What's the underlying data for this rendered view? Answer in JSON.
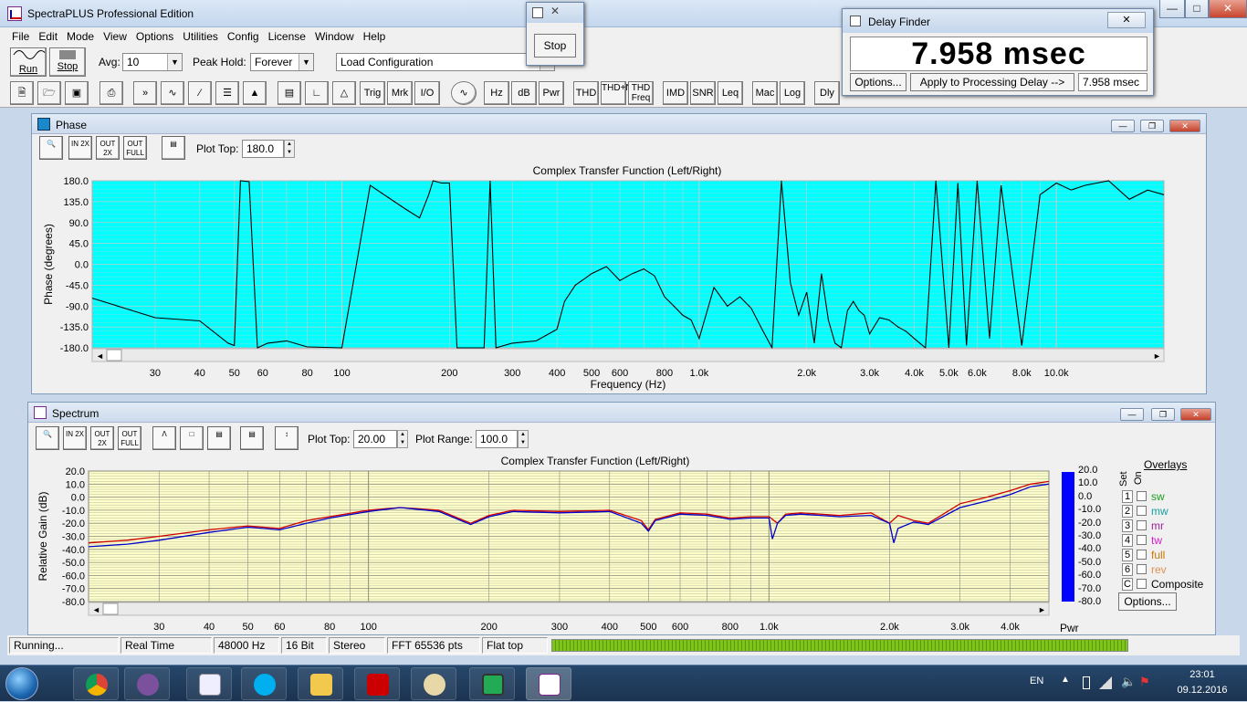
{
  "app": {
    "title": "SpectraPLUS Professional Edition"
  },
  "menu": [
    "File",
    "Edit",
    "Mode",
    "View",
    "Options",
    "Utilities",
    "Config",
    "License",
    "Window",
    "Help"
  ],
  "toolbar": {
    "run_label": "Run",
    "stop_label": "Stop",
    "avg_label": "Avg:",
    "avg_value": "10",
    "peak_hold_label": "Peak Hold:",
    "peak_hold_value": "Forever",
    "config_value": "Load Configuration",
    "buttons2": [
      "Trig",
      "Mrk",
      "I/O",
      "Hz",
      "dB",
      "Pwr",
      "THD",
      "THD+N",
      "THD Freq",
      "IMD",
      "SNR",
      "Leq",
      "Mac",
      "Log",
      "Dly"
    ]
  },
  "stop_window": {
    "stop_label": "Stop"
  },
  "delay_finder": {
    "title": "Delay Finder",
    "value": "7.958 msec",
    "options_label": "Options...",
    "apply_label": "Apply to Processing Delay -->",
    "result": "7.958 msec"
  },
  "phase_window": {
    "title": "Phase",
    "plot_top_label": "Plot Top:",
    "plot_top_value": "180.0",
    "zoom_labels": [
      "IN 2X",
      "OUT 2X",
      "OUT FULL"
    ]
  },
  "spectrum_window": {
    "title": "Spectrum",
    "plot_top_label": "Plot Top:",
    "plot_top_value": "20.00",
    "plot_range_label": "Plot Range:",
    "plot_range_value": "100.0",
    "zoom_labels": [
      "IN 2X",
      "OUT 2X",
      "OUT FULL"
    ],
    "pwr_label": "Pwr",
    "overlays_title": "Overlays",
    "set_label": "Set",
    "on_label": "On",
    "overlays": [
      {
        "n": "1",
        "name": "sw",
        "color": "#1a9e1a"
      },
      {
        "n": "2",
        "name": "mw",
        "color": "#1aa0a0"
      },
      {
        "n": "3",
        "name": "mr",
        "color": "#a0209a"
      },
      {
        "n": "4",
        "name": "tw",
        "color": "#d020c8"
      },
      {
        "n": "5",
        "name": "full",
        "color": "#c87800"
      },
      {
        "n": "6",
        "name": "rev",
        "color": "#e09050"
      },
      {
        "n": "C",
        "name": "Composite",
        "color": "#000000"
      }
    ],
    "overlays_options_label": "Options..."
  },
  "chart_data": [
    {
      "type": "line",
      "title": "Complex Transfer Function (Left/Right)",
      "xlabel": "Frequency (Hz)",
      "ylabel": "Phase (degrees)",
      "xscale": "log",
      "xlim": [
        20,
        20000
      ],
      "ylim": [
        -180,
        180
      ],
      "yticks": [
        "180.0",
        "135.0",
        "90.0",
        "45.0",
        "0.0",
        "-45.0",
        "-90.0",
        "-135.0",
        "-180.0"
      ],
      "xticks": [
        "30",
        "40",
        "50",
        "60",
        "80",
        "100",
        "200",
        "300",
        "400",
        "500",
        "600",
        "800",
        "1.0k",
        "2.0k",
        "3.0k",
        "4.0k",
        "5.0k",
        "6.0k",
        "8.0k",
        "10.0k"
      ],
      "background": "#00ffff",
      "series": [
        {
          "color": "#000000",
          "x": [
            20,
            30,
            40,
            48,
            50,
            52,
            55,
            58,
            62,
            70,
            80,
            100,
            120,
            150,
            165,
            175,
            180,
            190,
            200,
            210,
            230,
            250,
            260,
            270,
            300,
            350,
            400,
            420,
            450,
            480,
            500,
            550,
            600,
            650,
            700,
            750,
            800,
            850,
            900,
            950,
            1000,
            1100,
            1200,
            1300,
            1400,
            1500,
            1600,
            1700,
            1800,
            1900,
            2000,
            2100,
            2200,
            2300,
            2400,
            2500,
            2600,
            2700,
            2800,
            2900,
            3000,
            3200,
            3400,
            3600,
            3800,
            4000,
            4300,
            4600,
            5000,
            5300,
            5600,
            6000,
            6500,
            7000,
            8000,
            9000,
            10000,
            11000,
            12000,
            14000,
            16000,
            18000,
            20000
          ],
          "y": [
            -73,
            -115,
            -122,
            -170,
            -175,
            180,
            178,
            -180,
            -170,
            -165,
            -178,
            -180,
            170,
            120,
            100,
            150,
            180,
            175,
            175,
            -180,
            -180,
            -180,
            180,
            -180,
            -170,
            -165,
            -140,
            -80,
            -45,
            -30,
            -20,
            -5,
            -35,
            -20,
            -10,
            -25,
            -70,
            -90,
            -110,
            -120,
            -160,
            -50,
            -90,
            -70,
            -95,
            -140,
            -180,
            180,
            -40,
            -110,
            -60,
            -170,
            -20,
            -120,
            -170,
            -180,
            -100,
            -80,
            -100,
            -110,
            -150,
            -115,
            -120,
            -135,
            -145,
            -160,
            -180,
            180,
            -180,
            175,
            -175,
            180,
            -160,
            170,
            -175,
            150,
            175,
            160,
            170,
            180,
            140,
            160,
            150
          ]
        }
      ]
    },
    {
      "type": "line",
      "title": "Complex Transfer Function (Left/Right)",
      "ylabel": "Relative Gain (dB)",
      "xscale": "log",
      "xlim": [
        20,
        5000
      ],
      "ylim": [
        -80,
        20
      ],
      "yticks": [
        "20.0",
        "10.0",
        "0.0",
        "-10.0",
        "-20.0",
        "-30.0",
        "-40.0",
        "-50.0",
        "-60.0",
        "-70.0",
        "-80.0"
      ],
      "xticks": [
        "30",
        "40",
        "50",
        "60",
        "80",
        "100",
        "200",
        "300",
        "400",
        "500",
        "600",
        "800",
        "1.0k",
        "2.0k",
        "3.0k",
        "4.0k"
      ],
      "background": "#ffffcc",
      "series": [
        {
          "color": "#cc0000",
          "x": [
            20,
            25,
            30,
            40,
            50,
            60,
            70,
            80,
            100,
            120,
            150,
            180,
            200,
            230,
            300,
            400,
            480,
            500,
            520,
            600,
            700,
            800,
            900,
            1000,
            1050,
            1100,
            1200,
            1500,
            1800,
            2000,
            2100,
            2300,
            2500,
            3000,
            3500,
            4000,
            4500,
            5000
          ],
          "y": [
            -35,
            -33,
            -30,
            -25,
            -22,
            -24,
            -18,
            -15,
            -10,
            -8,
            -10,
            -20,
            -14,
            -10,
            -11,
            -10,
            -18,
            -25,
            -17,
            -12,
            -13,
            -16,
            -15,
            -15,
            -20,
            -13,
            -12,
            -14,
            -12,
            -20,
            -14,
            -18,
            -20,
            -5,
            0,
            5,
            10,
            12
          ]
        },
        {
          "color": "#0000cc",
          "x": [
            20,
            25,
            30,
            40,
            50,
            60,
            70,
            80,
            100,
            120,
            150,
            180,
            200,
            230,
            300,
            400,
            480,
            500,
            520,
            600,
            700,
            800,
            900,
            1000,
            1020,
            1050,
            1100,
            1200,
            1500,
            1800,
            2000,
            2050,
            2100,
            2300,
            2500,
            3000,
            3500,
            4000,
            4500,
            5000
          ],
          "y": [
            -38,
            -36,
            -33,
            -27,
            -23,
            -25,
            -20,
            -16,
            -11,
            -8,
            -11,
            -21,
            -15,
            -11,
            -12,
            -11,
            -20,
            -26,
            -18,
            -13,
            -14,
            -17,
            -16,
            -16,
            -32,
            -20,
            -14,
            -13,
            -15,
            -14,
            -20,
            -35,
            -24,
            -19,
            -21,
            -8,
            -3,
            2,
            8,
            10
          ]
        }
      ]
    }
  ],
  "status": {
    "running": "Running...",
    "mode": "Real Time",
    "rate": "48000 Hz",
    "bits": "16 Bit",
    "channels": "Stereo",
    "fft": "FFT 65536 pts",
    "window": "Flat top"
  },
  "taskbar": {
    "lang": "EN",
    "time": "23:01",
    "date": "09.12.2016"
  }
}
